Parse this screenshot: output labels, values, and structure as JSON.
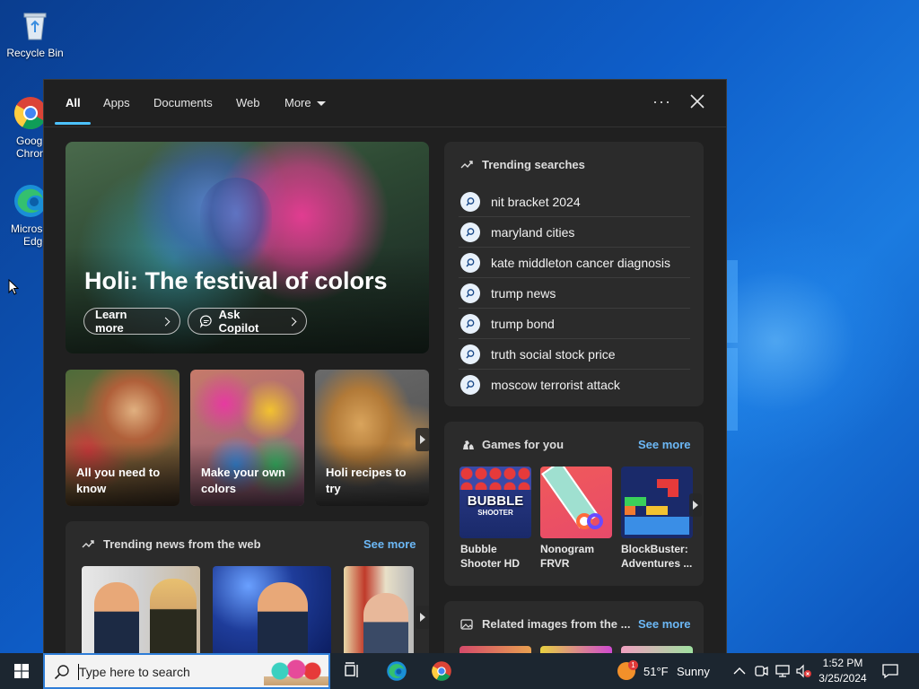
{
  "desktop": {
    "icons": [
      {
        "label": "Recycle Bin"
      },
      {
        "label_line1": "Goog",
        "label_line2": "Chron"
      },
      {
        "label_line1": "Micros",
        "label_line2": "Edge"
      }
    ]
  },
  "search_panel": {
    "tabs": [
      "All",
      "Apps",
      "Documents",
      "Web",
      "More"
    ],
    "active_tab": "All",
    "hero": {
      "title": "Holi: The festival of colors",
      "learn_more": "Learn more",
      "ask_copilot": "Ask Copilot"
    },
    "cards": [
      {
        "label": "All you need to know"
      },
      {
        "label": "Make your own colors"
      },
      {
        "label": "Holi recipes to try"
      }
    ],
    "trending_news": {
      "title": "Trending news from the web",
      "see_more": "See more"
    },
    "trending_searches": {
      "title": "Trending searches",
      "items": [
        "nit bracket 2024",
        "maryland cities",
        "kate middleton cancer diagnosis",
        "trump news",
        "trump bond",
        "truth social stock price",
        "moscow terrorist attack"
      ]
    },
    "games": {
      "title": "Games for you",
      "see_more": "See more",
      "items": [
        {
          "name_line1": "Bubble",
          "name_line2": "Shooter HD",
          "tile_text": "BUBBLE",
          "tile_sub": "SHOOTER"
        },
        {
          "name_line1": "Nonogram",
          "name_line2": "FRVR"
        },
        {
          "name_line1": "BlockBuster:",
          "name_line2": "Adventures ..."
        }
      ]
    },
    "related_images": {
      "title": "Related images from the ...",
      "see_more": "See more"
    }
  },
  "taskbar": {
    "search_placeholder": "Type here to search",
    "weather": {
      "temp": "51°F",
      "condition": "Sunny",
      "badge": "1"
    },
    "clock": {
      "time": "1:52 PM",
      "date": "3/25/2024"
    }
  },
  "colors": {
    "accent": "#4cc2ff",
    "link": "#6cb8f6",
    "panel_bg": "#202020",
    "card_bg": "#2b2b2b"
  }
}
